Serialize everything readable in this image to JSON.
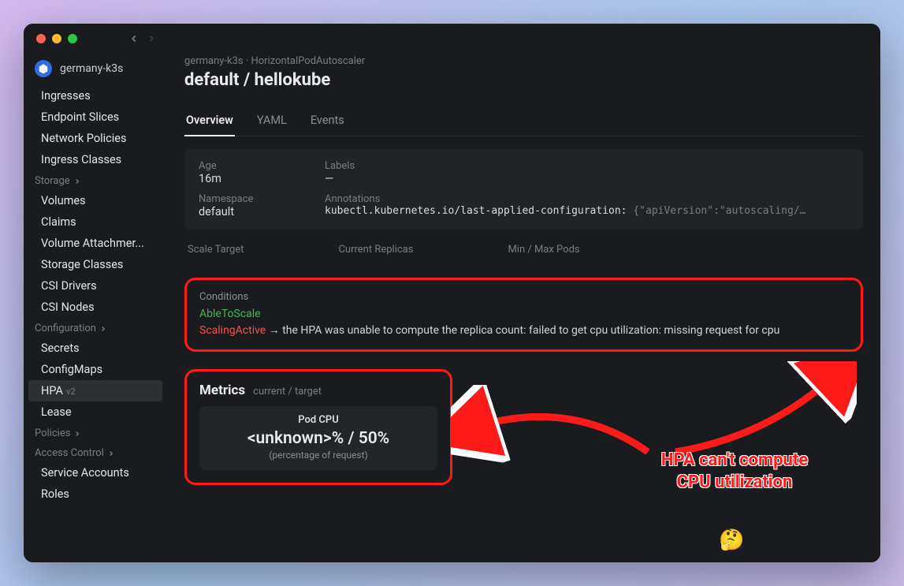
{
  "cluster": {
    "name": "germany-k3s"
  },
  "sidebar": {
    "items_net": [
      "Ingresses",
      "Endpoint Slices",
      "Network Policies",
      "Ingress Classes"
    ],
    "group_storage": "Storage",
    "items_storage": [
      "Volumes",
      "Claims",
      "Volume Attachmer...",
      "Storage Classes",
      "CSI Drivers",
      "CSI Nodes"
    ],
    "group_config": "Configuration",
    "items_config": [
      "Secrets",
      "ConfigMaps",
      "HPA",
      "Lease"
    ],
    "hpa_badge": "v2",
    "group_policies": "Policies",
    "group_access": "Access Control",
    "items_access": [
      "Service Accounts",
      "Roles"
    ]
  },
  "breadcrumb": {
    "cluster": "germany-k3s",
    "sep": "·",
    "kind": "HorizontalPodAutoscaler"
  },
  "title": {
    "ns": "default",
    "sep": "/",
    "name": "hellokube"
  },
  "tabs": [
    "Overview",
    "YAML",
    "Events"
  ],
  "info": {
    "age_label": "Age",
    "age": "16m",
    "labels_label": "Labels",
    "labels": "—",
    "ns_label": "Namespace",
    "ns": "default",
    "ann_label": "Annotations",
    "ann_key": "kubectl.kubernetes.io/last-applied-configuration:",
    "ann_val": "{\"apiVersion\":\"autoscaling/…"
  },
  "scale": {
    "target": "Scale Target",
    "replicas": "Current Replicas",
    "minmax": "Min / Max Pods"
  },
  "cond": {
    "title": "Conditions",
    "able": "AbleToScale",
    "active": "ScalingActive",
    "arrow": "→",
    "msg": "the HPA was unable to compute the replica count: failed to get cpu utilization: missing request for cpu"
  },
  "metrics": {
    "title": "Metrics",
    "sub": "current / target",
    "card_name": "Pod CPU",
    "card_val": "<unknown>% / 50%",
    "card_note": "(percentage of request)"
  },
  "annotation": {
    "line1": "HPA can't compute",
    "line2": "CPU utilization",
    "emoji": "🤔"
  }
}
